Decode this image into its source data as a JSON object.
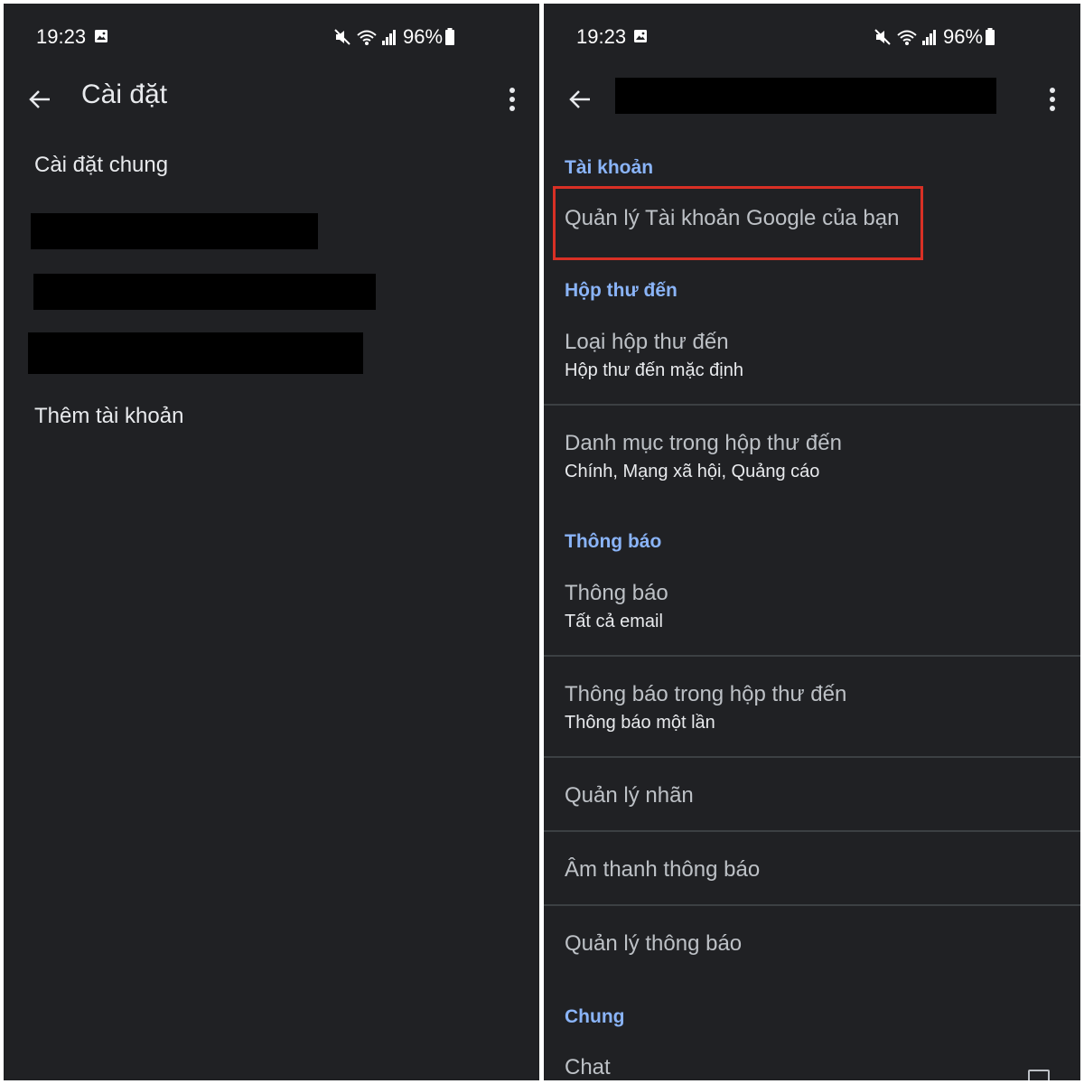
{
  "status": {
    "time": "19:23",
    "battery": "96%"
  },
  "left": {
    "title": "Cài đặt",
    "general_settings": "Cài đặt chung",
    "add_account": "Thêm tài khoản"
  },
  "right": {
    "sections": {
      "account": "Tài khoản",
      "inbox": "Hộp thư đến",
      "notifications": "Thông báo",
      "general": "Chung"
    },
    "items": {
      "manage_google_account": "Quản lý Tài khoản Google của bạn",
      "inbox_type": {
        "title": "Loại hộp thư đến",
        "subtitle": "Hộp thư đến mặc định"
      },
      "inbox_categories": {
        "title": "Danh mục trong hộp thư đến",
        "subtitle": "Chính, Mạng xã hội, Quảng cáo"
      },
      "notifications": {
        "title": "Thông báo",
        "subtitle": "Tất cả email"
      },
      "inbox_notifications": {
        "title": "Thông báo trong hộp thư đến",
        "subtitle": "Thông báo một lần"
      },
      "manage_labels": "Quản lý nhãn",
      "notification_sound": "Âm thanh thông báo",
      "manage_notifications": "Quản lý thông báo",
      "chat": "Chat"
    }
  },
  "colors": {
    "background": "#202124",
    "section_header": "#8ab4f8",
    "highlight": "#d93025"
  }
}
